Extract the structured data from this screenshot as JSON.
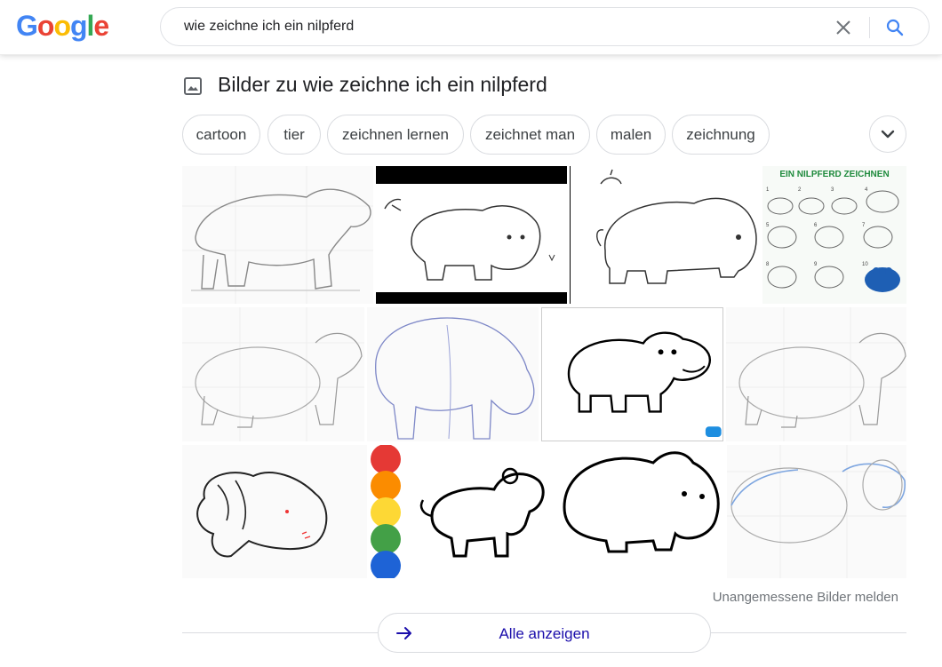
{
  "header": {
    "logo_letters": [
      "G",
      "o",
      "o",
      "g",
      "l",
      "e"
    ],
    "logo_colors": [
      "#4285f4",
      "#ea4335",
      "#fbbc05",
      "#4285f4",
      "#34a853",
      "#ea4335"
    ],
    "search_query": "wie zeichne ich ein nilpferd",
    "clear_icon": "close-icon",
    "search_icon": "search-icon"
  },
  "section": {
    "title": "Bilder zu wie zeichne ich ein nilpferd",
    "icon": "image-icon"
  },
  "chips": [
    {
      "label": "cartoon"
    },
    {
      "label": "tier"
    },
    {
      "label": "zeichnen lernen"
    },
    {
      "label": "zeichnet man"
    },
    {
      "label": "malen"
    },
    {
      "label": "zeichnung"
    }
  ],
  "tile_texts": {
    "tutorial_title": "EIN NILPFERD ZEICHNEN",
    "steps": [
      "1",
      "2",
      "3",
      "4",
      "5",
      "6",
      "7",
      "8",
      "9",
      "10"
    ]
  },
  "footer": {
    "report_label": "Unangemessene Bilder melden",
    "show_all_label": "Alle anzeigen"
  },
  "colors": {
    "link": "#1a0dab",
    "search_blue": "#4285f4",
    "paint_dots": [
      "#e53935",
      "#fb8c00",
      "#fdd835",
      "#43a047",
      "#1e63d6"
    ],
    "hippo_blue": "#1e5fb4"
  }
}
